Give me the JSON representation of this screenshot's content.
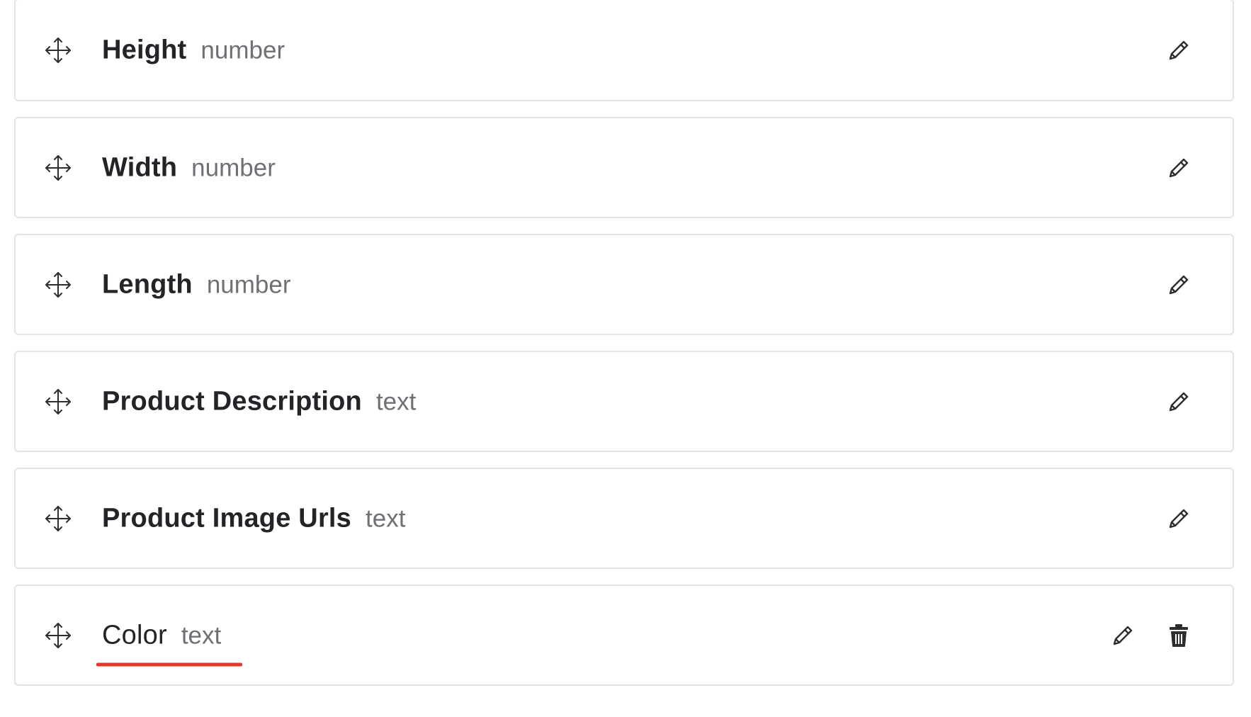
{
  "fields": [
    {
      "name": "Height",
      "type": "number",
      "show_delete": false,
      "highlighted": false
    },
    {
      "name": "Width",
      "type": "number",
      "show_delete": false,
      "highlighted": false
    },
    {
      "name": "Length",
      "type": "number",
      "show_delete": false,
      "highlighted": false
    },
    {
      "name": "Product Description",
      "type": "text",
      "show_delete": false,
      "highlighted": false
    },
    {
      "name": "Product Image Urls",
      "type": "text",
      "show_delete": false,
      "highlighted": false
    },
    {
      "name": "Color",
      "type": "text",
      "show_delete": true,
      "highlighted": true
    }
  ],
  "icons": {
    "drag": "move-arrows-icon",
    "edit": "pencil-icon",
    "delete": "trash-icon"
  },
  "colors": {
    "border": "#e3e3e3",
    "name_text": "#222428",
    "type_text": "#6e7076",
    "highlight": "#e03a2b",
    "icon": "#2b2d31"
  }
}
